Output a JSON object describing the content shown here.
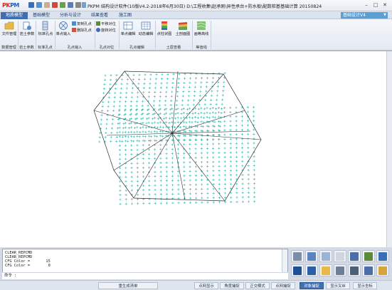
{
  "titlebar": {
    "logo_text": "PKPM",
    "title": "PKPM 结构设计软件(10版V4.2-2018年6月30日) D:\\工程收集\\赵承刚\\异性承台+防水板\\配数桩基基础计算 20150824",
    "min": "–",
    "max": "□",
    "close": "✕"
  },
  "tabs": [
    {
      "label": "地质模型",
      "active": true
    },
    {
      "label": "基础模型",
      "active": false
    },
    {
      "label": "分析与设计",
      "active": false
    },
    {
      "label": "结果查看",
      "active": false
    },
    {
      "label": "施工图",
      "active": false
    }
  ],
  "module_select": {
    "value": "基础设计V4"
  },
  "ribbon": {
    "items": [
      {
        "label": "文件管理",
        "icon": "folder-icon"
      },
      {
        "label": "岩土参数",
        "icon": "soil-params-icon"
      },
      {
        "label": "标准孔点",
        "icon": "std-hole-icon"
      },
      {
        "label": "单点输入",
        "icon": "point-input-icon"
      },
      {
        "label": "复制孔点",
        "icon": "copy-hole-icon"
      },
      {
        "label": "删除孔点",
        "icon": "delete-hole-icon"
      },
      {
        "label": "平移对位",
        "icon": "move-align-icon"
      },
      {
        "label": "旋转对位",
        "icon": "rotate-align-icon"
      },
      {
        "label": "单点编辑",
        "icon": "point-edit-icon"
      },
      {
        "label": "动态编辑",
        "icon": "dynamic-edit-icon"
      },
      {
        "label": "点柱状图",
        "icon": "column-chart-icon"
      },
      {
        "label": "土剖面图",
        "icon": "soil-section-icon"
      },
      {
        "label": "画等高线",
        "icon": "contour-icon"
      }
    ],
    "groups": [
      {
        "label": "数据管理"
      },
      {
        "label": "岩土参数"
      },
      {
        "label": "标准孔点"
      },
      {
        "label": "孔点输入"
      },
      {
        "label": "孔点对位"
      },
      {
        "label": "孔点编辑"
      },
      {
        "label": "土层查看"
      },
      {
        "label": "等值线"
      }
    ]
  },
  "command": {
    "lines": [
      "CLEAR_REPCMD",
      "CLEAR_REPCMD",
      "CFG Color =       15",
      "CFG Color =        0"
    ],
    "prompt": "命令 :"
  },
  "statusbar": {
    "buttons": [
      {
        "label": "重生成清单",
        "active": false
      },
      {
        "label": "点网显示",
        "active": false
      },
      {
        "label": "角度捕捉",
        "active": false
      },
      {
        "label": "正交模式",
        "active": false
      },
      {
        "label": "点网捕捉",
        "active": false
      },
      {
        "label": "对象捕捉",
        "active": true
      },
      {
        "label": "显示叉丝",
        "active": false
      },
      {
        "label": "显示坐标",
        "active": false
      }
    ]
  },
  "colors": {
    "accent": "#3f6fb1",
    "grid_points": "#2bb8b0",
    "outline": "#2a2a2a"
  },
  "palette_icons": [
    "box-view-icon",
    "box-solid-icon",
    "layer-icon",
    "eraser-icon",
    "calculator-icon",
    "keyboard-icon",
    "print-icon",
    "font-larger-icon",
    "font-smaller-icon",
    "folder-open-icon",
    "dimension-icon",
    "measure-icon",
    "angle-icon",
    "pen-edit-icon"
  ]
}
